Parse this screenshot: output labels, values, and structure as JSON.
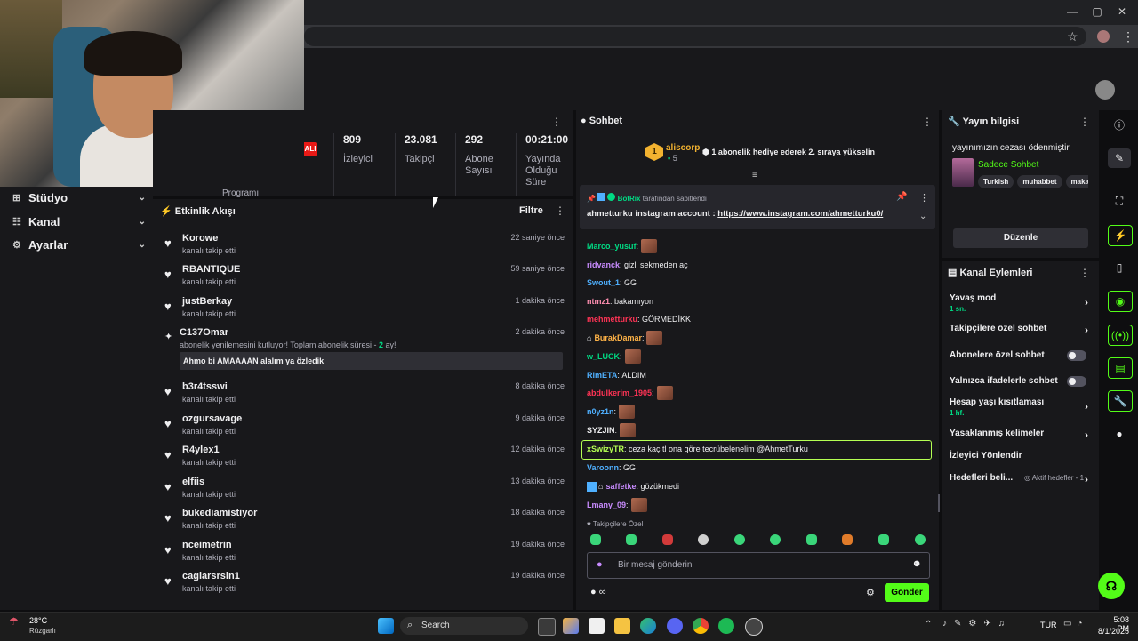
{
  "browser": {
    "window_controls": [
      "—",
      "▢",
      "✕"
    ],
    "star_icon": "☆",
    "menu_icon": "⋮"
  },
  "sidebar": {
    "items": [
      {
        "label": "Stüdyo",
        "icon": "studio-icon"
      },
      {
        "label": "Kanal",
        "icon": "channel-icon"
      },
      {
        "label": "Ayarlar",
        "icon": "gear-icon"
      }
    ],
    "partial_text": "Programı"
  },
  "stats": {
    "badge": "ALI",
    "items": [
      {
        "value": "809",
        "label": "İzleyici"
      },
      {
        "value": "23.081",
        "label": "Takipçi"
      },
      {
        "value": "292",
        "label": "Abone Sayısı"
      },
      {
        "value": "00:21:00",
        "label": "Yayında Olduğu Süre"
      }
    ]
  },
  "feed": {
    "title": "Etkinlik Akışı",
    "filter_label": "Filtre",
    "items": [
      {
        "name": "Korowe",
        "sub": "kanalı takip etti",
        "time": "22 saniye önce"
      },
      {
        "name": "RBANTIQUE",
        "sub": "kanalı takip etti",
        "time": "59 saniye önce"
      },
      {
        "name": "justBerkay",
        "sub": "kanalı takip etti",
        "time": "1 dakika önce"
      },
      {
        "name": "b3r4tsswi",
        "sub": "kanalı takip etti",
        "time": "8 dakika önce"
      },
      {
        "name": "ozgursavage",
        "sub": "kanalı takip etti",
        "time": "9 dakika önce"
      },
      {
        "name": "R4ylex1",
        "sub": "kanalı takip etti",
        "time": "12 dakika önce"
      },
      {
        "name": "elfiis",
        "sub": "kanalı takip etti",
        "time": "13 dakika önce"
      },
      {
        "name": "bukediamistiyor",
        "sub": "kanalı takip etti",
        "time": "18 dakika önce"
      },
      {
        "name": "nceimetrin",
        "sub": "kanalı takip etti",
        "time": "19 dakika önce"
      },
      {
        "name": "caglarsrsln1",
        "sub": "kanalı takip etti",
        "time": "19 dakika önce"
      }
    ],
    "sub_event": {
      "name": "C137Omar",
      "time": "2 dakika önce",
      "text_before": "abonelik yenilemesini kutluyor! Toplam abonelik süresi - ",
      "months": "2",
      "text_after": " ay!",
      "message": "Ahmo bi AMAAAAN alalım ya özledik"
    }
  },
  "chat": {
    "title": "Sohbet",
    "leader": {
      "rank": "1",
      "name": "aliscorp",
      "count": "5",
      "text": "1 abonelik hediye ederek 2. sıraya yükselin"
    },
    "pinned": {
      "by": "BotRix",
      "by_suffix": "tarafından sabitlendi",
      "message": "ahmetturku instagram account : ",
      "link": "https://www.instagram.com/ahmetturku0/"
    },
    "messages": [
      {
        "user": "Marco_yusuf",
        "color": "#00db84",
        "text": "",
        "emote": true
      },
      {
        "user": "ridvanck",
        "color": "#c98cff",
        "text": "gizli sekmeden aç",
        "emote": false
      },
      {
        "user": "Swout_1",
        "color": "#4fb0ff",
        "text": "GG",
        "emote": false
      },
      {
        "user": "ntmz1",
        "color": "#ff8fb1",
        "text": "bakamıyon",
        "emote": false
      },
      {
        "user": "mehmetturku",
        "color": "#ff3355",
        "text": "GÖRMEDİKK",
        "emote": false
      },
      {
        "user": "BurakDamar",
        "color": "#ffb347",
        "text": "",
        "emote": true
      },
      {
        "user": "w_LUCK",
        "color": "#00db84",
        "text": "",
        "emote": true
      },
      {
        "user": "RimETA",
        "color": "#4fb0ff",
        "text": "ALDIM",
        "emote": false
      },
      {
        "user": "abdulkerim_1905",
        "color": "#ff3355",
        "text": "",
        "emote": true
      },
      {
        "user": "n0yz1n",
        "color": "#4fb0ff",
        "text": "",
        "emote": true
      },
      {
        "user": "SYZJIN",
        "color": "#efeff1",
        "text": "",
        "emote": true
      },
      {
        "user": "xSwizyTR",
        "color": "#b4ff53",
        "text": "ceza kaç tl ona göre tecrübelenelim @AhmetTurku",
        "emote": false
      },
      {
        "user": "Varoonn",
        "color": "#4fb0ff",
        "text": "GG",
        "emote": false
      },
      {
        "user": "saffetke",
        "color": "#c98cff",
        "text": "gözükmedi",
        "emote": false
      },
      {
        "user": "Lmany_09",
        "color": "#c98cff",
        "text": "",
        "emote": true
      }
    ],
    "emote_bar_label": "Takipçilere Özel",
    "input_placeholder": "Bir mesaj gönderin",
    "send_label": "Gönder"
  },
  "stream_info": {
    "title": "Yayın bilgisi",
    "stream_title": "yayınımızın cezası ödenmiştir",
    "category": "Sadece Sohbet",
    "tags": [
      "Turkish",
      "muhabbet",
      "maka"
    ],
    "edit_label": "Düzenle"
  },
  "channel_actions": {
    "title": "Kanal Eylemleri",
    "items": [
      {
        "label": "Yavaş mod",
        "sub": "1 sn.",
        "control": "arrow"
      },
      {
        "label": "Takipçilere özel sohbet",
        "sub": "",
        "control": "arrow"
      },
      {
        "label": "Abonelere özel sohbet",
        "sub": "",
        "control": "toggle"
      },
      {
        "label": "Yalnızca ifadelerle sohbet",
        "sub": "",
        "control": "toggle"
      },
      {
        "label": "Hesap yaşı kısıtlaması",
        "sub": "1 hf.",
        "control": "arrow"
      },
      {
        "label": "Yasaklanmış kelimeler",
        "sub": "",
        "control": "arrow"
      },
      {
        "label": "İzleyici Yönlendir",
        "sub": "",
        "control": "none"
      },
      {
        "label": "Hedefleri beli...",
        "sub": "",
        "control": "goals"
      }
    ],
    "goals_label": "Aktif hedefler - 1"
  },
  "taskbar": {
    "weather_temp": "28°C",
    "weather_desc": "Rüzgarlı",
    "search_label": "Search",
    "language": "TUR",
    "time": "5:08 PM",
    "date": "8/1/2025"
  }
}
